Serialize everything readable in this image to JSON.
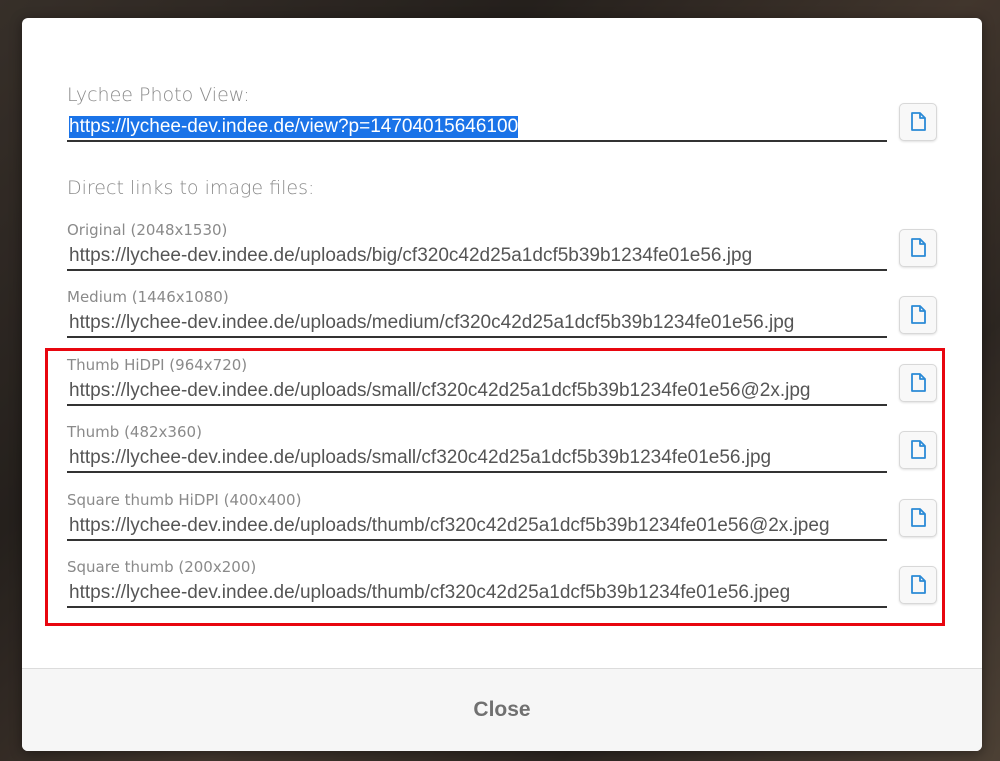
{
  "dialog": {
    "photo_view": {
      "label": "Lychee Photo View:",
      "url": "https://lychee-dev.indee.de/view?p=14704015646100"
    },
    "direct_links_label": "Direct links to image files:",
    "links": [
      {
        "label": "Original (2048x1530)",
        "url": "https://lychee-dev.indee.de/uploads/big/cf320c42d25a1dcf5b39b1234fe01e56.jpg"
      },
      {
        "label": "Medium (1446x1080)",
        "url": "https://lychee-dev.indee.de/uploads/medium/cf320c42d25a1dcf5b39b1234fe01e56.jpg"
      },
      {
        "label": "Thumb HiDPI (964x720)",
        "url": "https://lychee-dev.indee.de/uploads/small/cf320c42d25a1dcf5b39b1234fe01e56@2x.jpg"
      },
      {
        "label": "Thumb (482x360)",
        "url": "https://lychee-dev.indee.de/uploads/small/cf320c42d25a1dcf5b39b1234fe01e56.jpg"
      },
      {
        "label": "Square thumb HiDPI (400x400)",
        "url": "https://lychee-dev.indee.de/uploads/thumb/cf320c42d25a1dcf5b39b1234fe01e56@2x.jpeg"
      },
      {
        "label": "Square thumb (200x200)",
        "url": "https://lychee-dev.indee.de/uploads/thumb/cf320c42d25a1dcf5b39b1234fe01e56.jpeg"
      }
    ],
    "close_label": "Close"
  },
  "icons": {
    "copy": "copy-icon"
  },
  "colors": {
    "highlight_border": "#e8060f",
    "selection": "#1a73e8",
    "copy_icon": "#2b8ad6"
  }
}
